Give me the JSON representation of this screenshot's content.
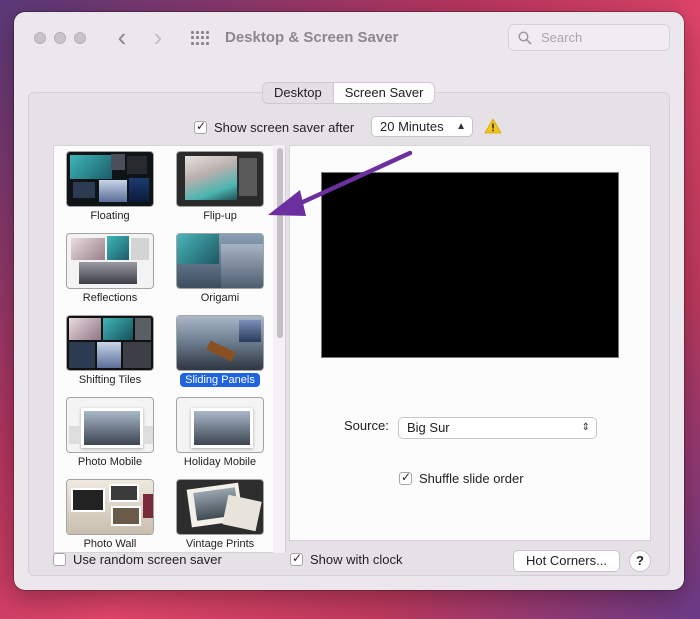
{
  "window": {
    "title": "Desktop & Screen Saver",
    "search_placeholder": "Search"
  },
  "tabs": [
    {
      "label": "Desktop",
      "active": false
    },
    {
      "label": "Screen Saver",
      "active": true
    }
  ],
  "show_after": {
    "checked": true,
    "label": "Show screen saver after",
    "value": "20 Minutes",
    "warning_icon": "warning-icon"
  },
  "savers": [
    {
      "label": "Floating"
    },
    {
      "label": "Flip-up"
    },
    {
      "label": "Reflections"
    },
    {
      "label": "Origami"
    },
    {
      "label": "Shifting Tiles"
    },
    {
      "label": "Sliding Panels",
      "selected": true
    },
    {
      "label": "Photo Mobile"
    },
    {
      "label": "Holiday Mobile"
    },
    {
      "label": "Photo Wall"
    },
    {
      "label": "Vintage Prints"
    }
  ],
  "source": {
    "label": "Source:",
    "value": "Big Sur"
  },
  "shuffle": {
    "checked": true,
    "label": "Shuffle slide order"
  },
  "bottom": {
    "random_label": "Use random screen saver",
    "random_checked": false,
    "clock_label": "Show with clock",
    "clock_checked": true,
    "hot_corners_label": "Hot Corners...",
    "help_label": "?"
  },
  "colors": {
    "accent": "#1f63dd",
    "annotation_arrow": "#6b2fa0",
    "warning": "#f5c518"
  }
}
